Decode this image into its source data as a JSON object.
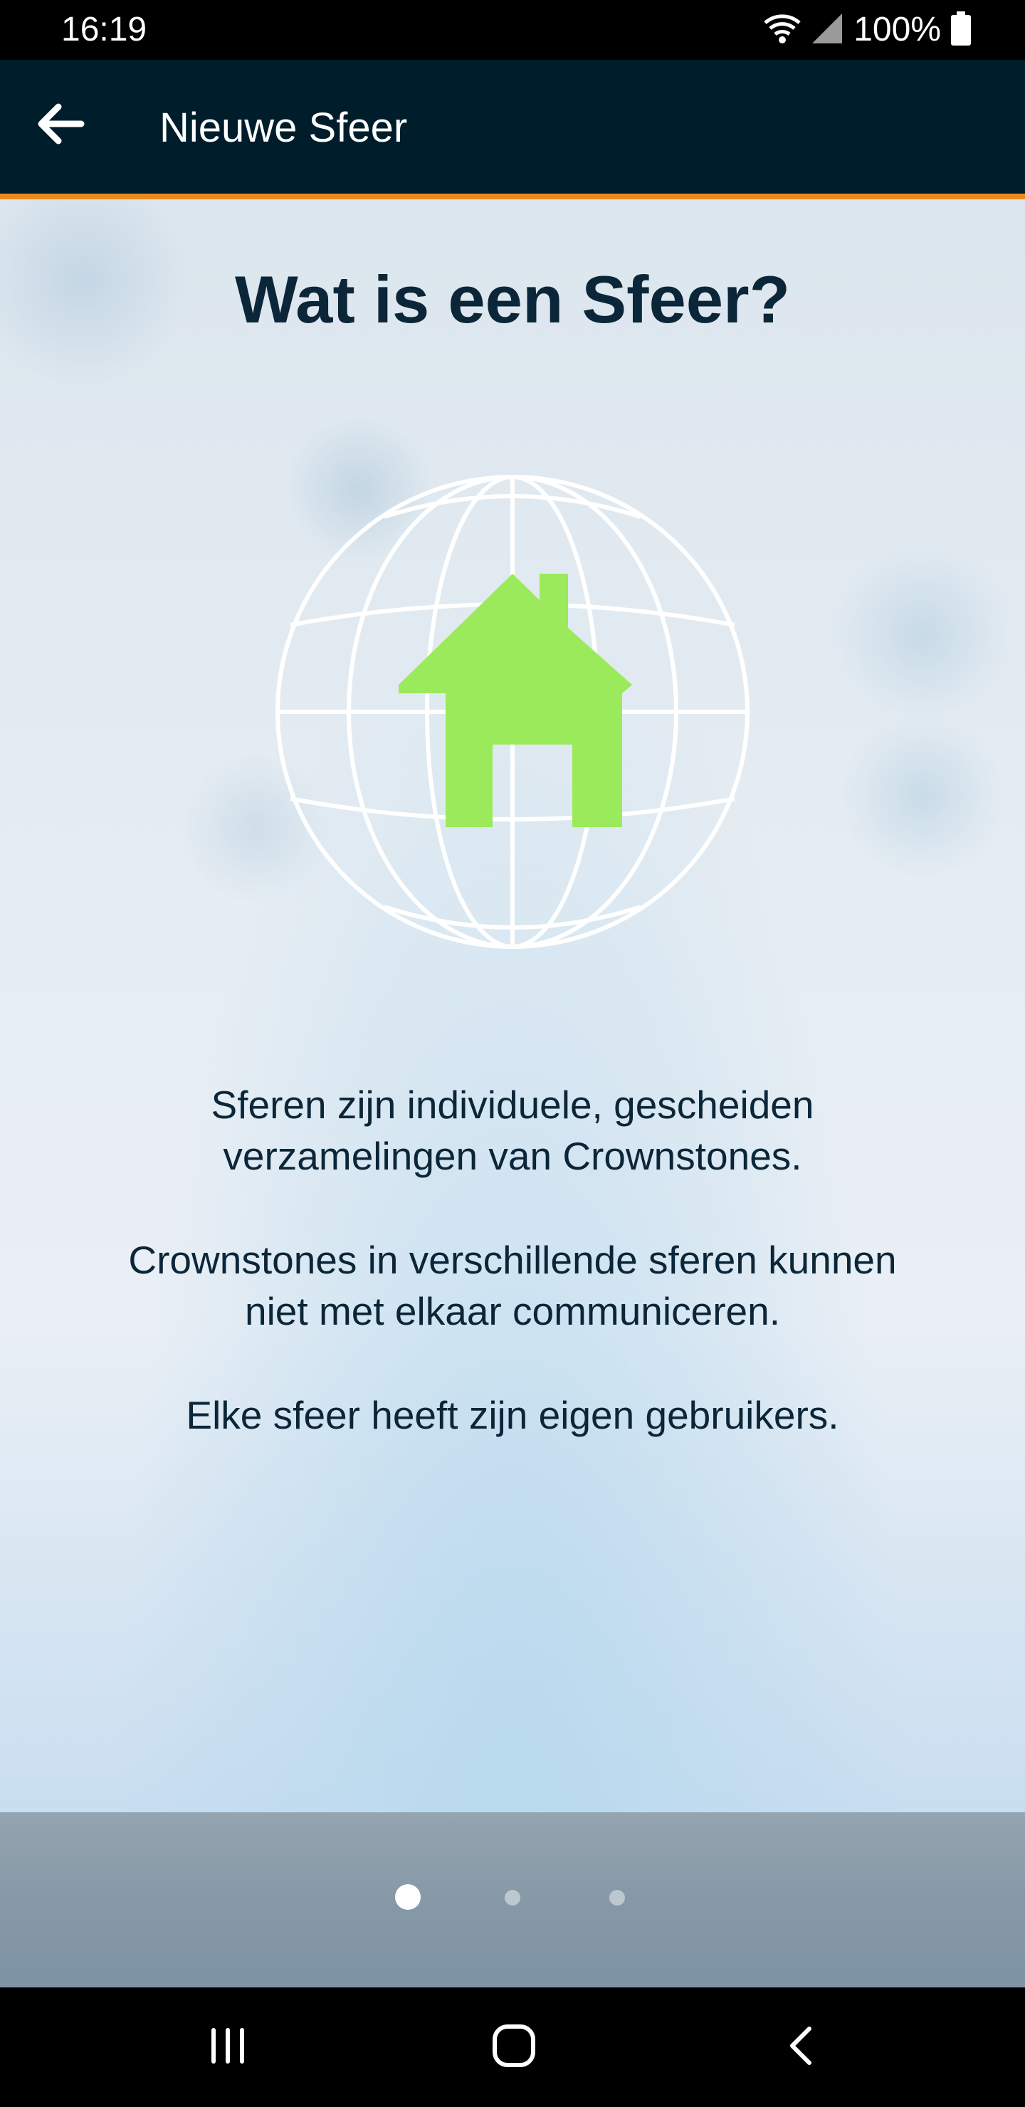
{
  "status_bar": {
    "time": "16:19",
    "battery_text": "100%",
    "icons": [
      "wifi-icon",
      "signal-icon",
      "battery-icon"
    ]
  },
  "app_bar": {
    "title": "Nieuwe Sfeer",
    "back_icon": "arrow-left-icon",
    "background_color": "#001d2c",
    "accent_color": "#ec8a1c"
  },
  "content": {
    "heading": "Wat is een Sfeer?",
    "illustration": {
      "icon": "globe-house-icon",
      "house_color": "#9bea5b",
      "globe_color": "#ffffff"
    },
    "paragraphs": [
      {
        "lines": [
          "Sferen zijn individuele, gescheiden",
          "verzamelingen van Crownstones."
        ]
      },
      {
        "lines": [
          "Crownstones in verschillende sferen kunnen",
          "niet met elkaar communiceren."
        ]
      },
      {
        "lines": [
          "Elke sfeer heeft zijn eigen gebruikers."
        ]
      }
    ],
    "text_color": "#0b2638"
  },
  "pager": {
    "page_count": 3,
    "active_page": 1
  },
  "nav_bar": {
    "buttons": [
      "recent-apps-icon",
      "home-icon",
      "back-icon"
    ]
  }
}
